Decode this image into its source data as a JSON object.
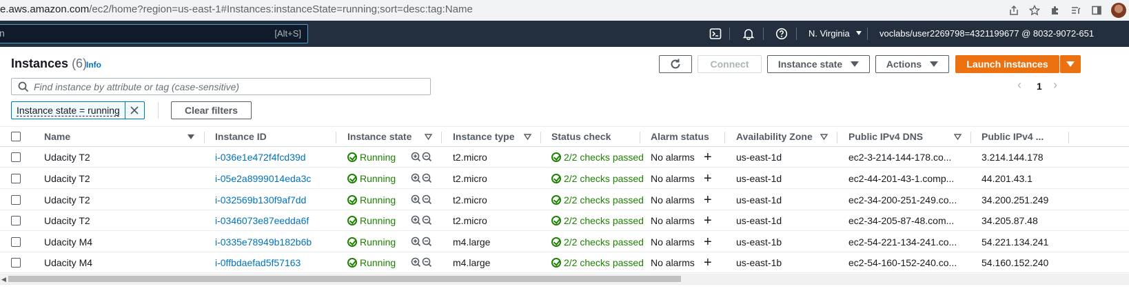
{
  "browser": {
    "url_host": "e.aws.amazon.com",
    "url_path": "/ec2/home?region=us-east-1#Instances:instanceState=running;sort=desc:tag:Name"
  },
  "topnav": {
    "search_partial": "n",
    "search_shortcut": "[Alt+S]",
    "region": "N. Virginia",
    "account": "voclabs/user2269798=4321199677 @ 8032-9072-651"
  },
  "header": {
    "title": "Instances",
    "count": "(6)",
    "info": "Info",
    "connect": "Connect",
    "instance_state": "Instance state",
    "actions": "Actions",
    "launch": "Launch instances"
  },
  "filter": {
    "placeholder": "Find instance by attribute or tag (case-sensitive)",
    "token": "Instance state = running",
    "clear": "Clear filters"
  },
  "pagination": {
    "page": "1"
  },
  "table": {
    "columns": [
      "Name",
      "Instance ID",
      "Instance state",
      "Instance type",
      "Status check",
      "Alarm status",
      "Availability Zone",
      "Public IPv4 DNS",
      "Public IPv4 ..."
    ],
    "rows": [
      {
        "name": "Udacity T2",
        "id": "i-036e1e472f4fcd39d",
        "state": "Running",
        "type": "t2.micro",
        "status": "2/2 checks passed",
        "alarm": "No alarms",
        "az": "us-east-1d",
        "dns": "ec2-3-214-144-178.co...",
        "ip": "3.214.144.178"
      },
      {
        "name": "Udacity T2",
        "id": "i-05e2a8999014eda3c",
        "state": "Running",
        "type": "t2.micro",
        "status": "2/2 checks passed",
        "alarm": "No alarms",
        "az": "us-east-1d",
        "dns": "ec2-44-201-43-1.comp...",
        "ip": "44.201.43.1"
      },
      {
        "name": "Udacity T2",
        "id": "i-032569b130f9af7dd",
        "state": "Running",
        "type": "t2.micro",
        "status": "2/2 checks passed",
        "alarm": "No alarms",
        "az": "us-east-1d",
        "dns": "ec2-34-200-251-249.co...",
        "ip": "34.200.251.249"
      },
      {
        "name": "Udacity T2",
        "id": "i-0346073e87eedda6f",
        "state": "Running",
        "type": "t2.micro",
        "status": "2/2 checks passed",
        "alarm": "No alarms",
        "az": "us-east-1d",
        "dns": "ec2-34-205-87-48.com...",
        "ip": "34.205.87.48"
      },
      {
        "name": "Udacity M4",
        "id": "i-0335e78949b182b6b",
        "state": "Running",
        "type": "m4.large",
        "status": "2/2 checks passed",
        "alarm": "No alarms",
        "az": "us-east-1b",
        "dns": "ec2-54-221-134-241.co...",
        "ip": "54.221.134.241"
      },
      {
        "name": "Udacity M4",
        "id": "i-0ffbdaefad5f57163",
        "state": "Running",
        "type": "m4.large",
        "status": "2/2 checks passed",
        "alarm": "No alarms",
        "az": "us-east-1b",
        "dns": "ec2-54-160-152-240.co...",
        "ip": "54.160.152.240"
      }
    ]
  },
  "colors": {
    "aws_nav": "#232f3e",
    "link": "#0073bb",
    "running": "#1d8102",
    "launch": "#ec7211"
  }
}
